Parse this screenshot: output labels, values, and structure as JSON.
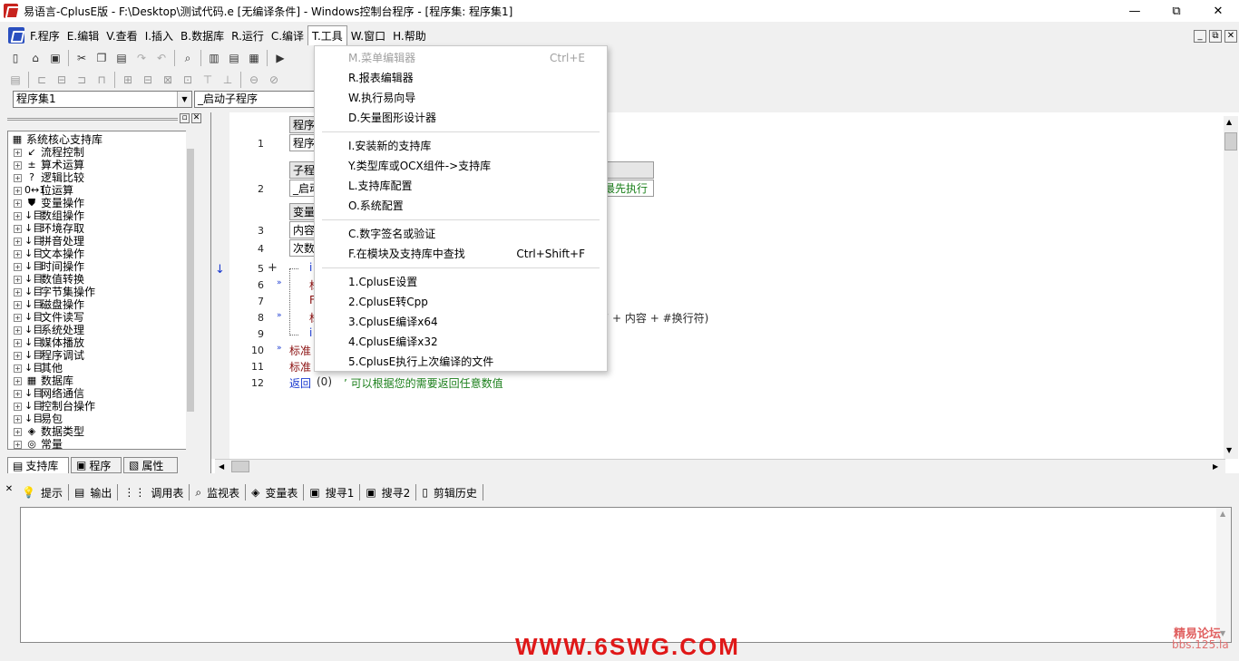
{
  "window": {
    "title": "易语言-CplusE版 - F:\\Desktop\\测试代码.e [无编译条件] - Windows控制台程序 - [程序集: 程序集1]",
    "minimize": "—",
    "maximize": "⧉",
    "close": "✕"
  },
  "menubar": [
    {
      "key": "F",
      "label": "F.程序"
    },
    {
      "key": "E",
      "label": "E.编辑"
    },
    {
      "key": "V",
      "label": "V.查看"
    },
    {
      "key": "I",
      "label": "I.插入"
    },
    {
      "key": "B",
      "label": "B.数据库"
    },
    {
      "key": "R",
      "label": "R.运行"
    },
    {
      "key": "C",
      "label": "C.编译"
    },
    {
      "key": "T",
      "label": "T.工具"
    },
    {
      "key": "W",
      "label": "W.窗口"
    },
    {
      "key": "H",
      "label": "H.帮助"
    }
  ],
  "combos": {
    "left": "程序集1",
    "right": "_启动子程序"
  },
  "tree": {
    "root": "系统核心支持库",
    "items": [
      {
        "label": "流程控制",
        "icon": "↙"
      },
      {
        "label": "算术运算",
        "icon": "±"
      },
      {
        "label": "逻辑比较",
        "icon": "?"
      },
      {
        "label": "位运算",
        "icon": "0↔1"
      },
      {
        "label": "变量操作",
        "icon": "⛊"
      },
      {
        "label": "数组操作",
        "icon": "↓目"
      },
      {
        "label": "环境存取",
        "icon": "↓目"
      },
      {
        "label": "拼音处理",
        "icon": "↓目"
      },
      {
        "label": "文本操作",
        "icon": "↓目"
      },
      {
        "label": "时间操作",
        "icon": "↓目"
      },
      {
        "label": "数值转换",
        "icon": "↓目"
      },
      {
        "label": "字节集操作",
        "icon": "↓目"
      },
      {
        "label": "磁盘操作",
        "icon": "↓目"
      },
      {
        "label": "文件读写",
        "icon": "↓目"
      },
      {
        "label": "系统处理",
        "icon": "↓目"
      },
      {
        "label": "媒体播放",
        "icon": "↓目"
      },
      {
        "label": "程序调试",
        "icon": "↓目"
      },
      {
        "label": "其他",
        "icon": "↓目"
      },
      {
        "label": "数据库",
        "icon": "▦"
      },
      {
        "label": "网络通信",
        "icon": "↓目"
      },
      {
        "label": "控制台操作",
        "icon": "↓目"
      },
      {
        "label": "易包",
        "icon": "↓目"
      },
      {
        "label": "数据类型",
        "icon": "◈"
      },
      {
        "label": "常量",
        "icon": "◎"
      }
    ]
  },
  "left_tabs": [
    "支持库",
    "程序",
    "属性"
  ],
  "editor": {
    "line_numbers": [
      "1",
      "2",
      "3",
      "4",
      "5",
      "6",
      "7",
      "8",
      "9",
      "10",
      "11",
      "12"
    ],
    "box1": [
      "程序",
      "程序"
    ],
    "box2": [
      "子程",
      "_启动"
    ],
    "box2_note": "最先执行",
    "box3": [
      "变量",
      "内容",
      "次数"
    ],
    "line8_tail": "”  + 内容 + #换行符)",
    "line10": "标准",
    "line11": "标准",
    "line12_kw": "返回",
    "line12_arg": "(0)",
    "line12_comment": "’ 可以根据您的需要返回任意数值",
    "frag5": "i",
    "frag6": "标",
    "frag7": "F",
    "frag8": "标",
    "frag9": "i"
  },
  "tools_menu": {
    "items": [
      {
        "label": "M.菜单编辑器",
        "shortcut": "Ctrl+E",
        "disabled": true
      },
      {
        "label": "R.报表编辑器",
        "shortcut": ""
      },
      {
        "label": "W.执行易向导",
        "shortcut": ""
      },
      {
        "label": "D.矢量图形设计器",
        "shortcut": ""
      },
      {
        "label": "I.安装新的支持库",
        "shortcut": ""
      },
      {
        "label": "Y.类型库或OCX组件->支持库",
        "shortcut": ""
      },
      {
        "label": "L.支持库配置",
        "shortcut": ""
      },
      {
        "label": "O.系统配置",
        "shortcut": ""
      },
      {
        "label": "C.数字签名或验证",
        "shortcut": ""
      },
      {
        "label": "F.在模块及支持库中查找",
        "shortcut": "Ctrl+Shift+F"
      },
      {
        "label": "1.CplusE设置",
        "shortcut": ""
      },
      {
        "label": "2.CplusE转Cpp",
        "shortcut": ""
      },
      {
        "label": "3.CplusE编译x64",
        "shortcut": ""
      },
      {
        "label": "4.CplusE编译x32",
        "shortcut": ""
      },
      {
        "label": "5.CplusE执行上次编译的文件",
        "shortcut": ""
      }
    ]
  },
  "bottom_tabs": [
    "提示",
    "输出",
    "调用表",
    "监视表",
    "变量表",
    "搜寻1",
    "搜寻2",
    "剪辑历史"
  ],
  "watermark": {
    "main": "WWW.6SWG.COM",
    "corner1": "精易论坛",
    "corner2": "bbs.125.la"
  },
  "colors": {
    "keyword": "#8b1010",
    "comment": "#1a7f1a",
    "watermark": "#e01818"
  }
}
